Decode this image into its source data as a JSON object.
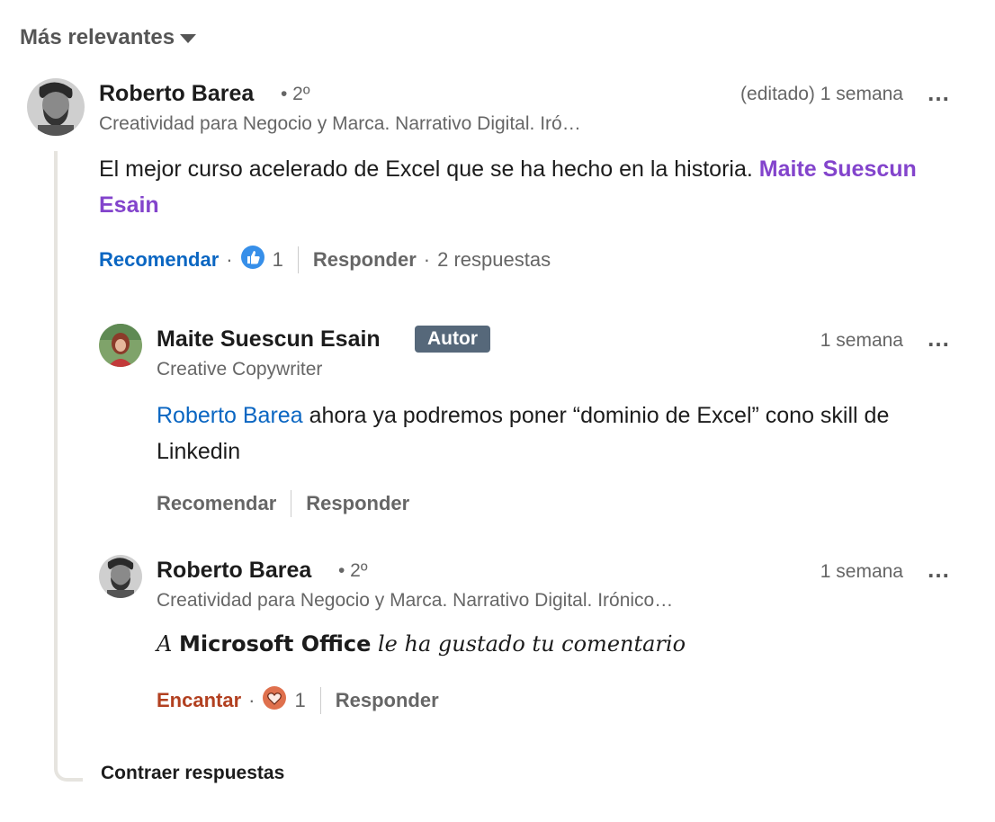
{
  "sort": {
    "label": "Más relevantes"
  },
  "comment": {
    "author": "Roberto Barea",
    "degree": "• 2º",
    "headline": "Creatividad para Negocio y Marca. Narrativo Digital. Iró…",
    "time": "(editado) 1 semana",
    "text": "El mejor curso acelerado de Excel que se ha hecho en la historia.",
    "mention": "Maite Suescun Esain",
    "actions": {
      "like": "Recomendar",
      "like_count": "1",
      "reply": "Responder",
      "replies": "2 respuestas"
    }
  },
  "replies": [
    {
      "author": "Maite Suescun Esain",
      "badge": "Autor",
      "headline": "Creative Copywriter",
      "time": "1 semana",
      "mention": "Roberto Barea",
      "text": "ahora ya podremos poner “dominio de Excel” cono skill de Linkedin",
      "actions": {
        "like": "Recomendar",
        "reply": "Responder"
      }
    },
    {
      "author": "Roberto Barea",
      "degree": "• 2º",
      "headline": "Creatividad para Negocio y Marca. Narrativo Digital. Irónico…",
      "time": "1 semana",
      "text_prefix": "A",
      "text_bold": "Microsoft Office",
      "text_suffix": "le ha gustado tu comentario",
      "actions": {
        "like": "Encantar",
        "like_count": "1",
        "reply": "Responder"
      }
    }
  ],
  "collapse": "Contraer respuestas",
  "more_icon": "…"
}
